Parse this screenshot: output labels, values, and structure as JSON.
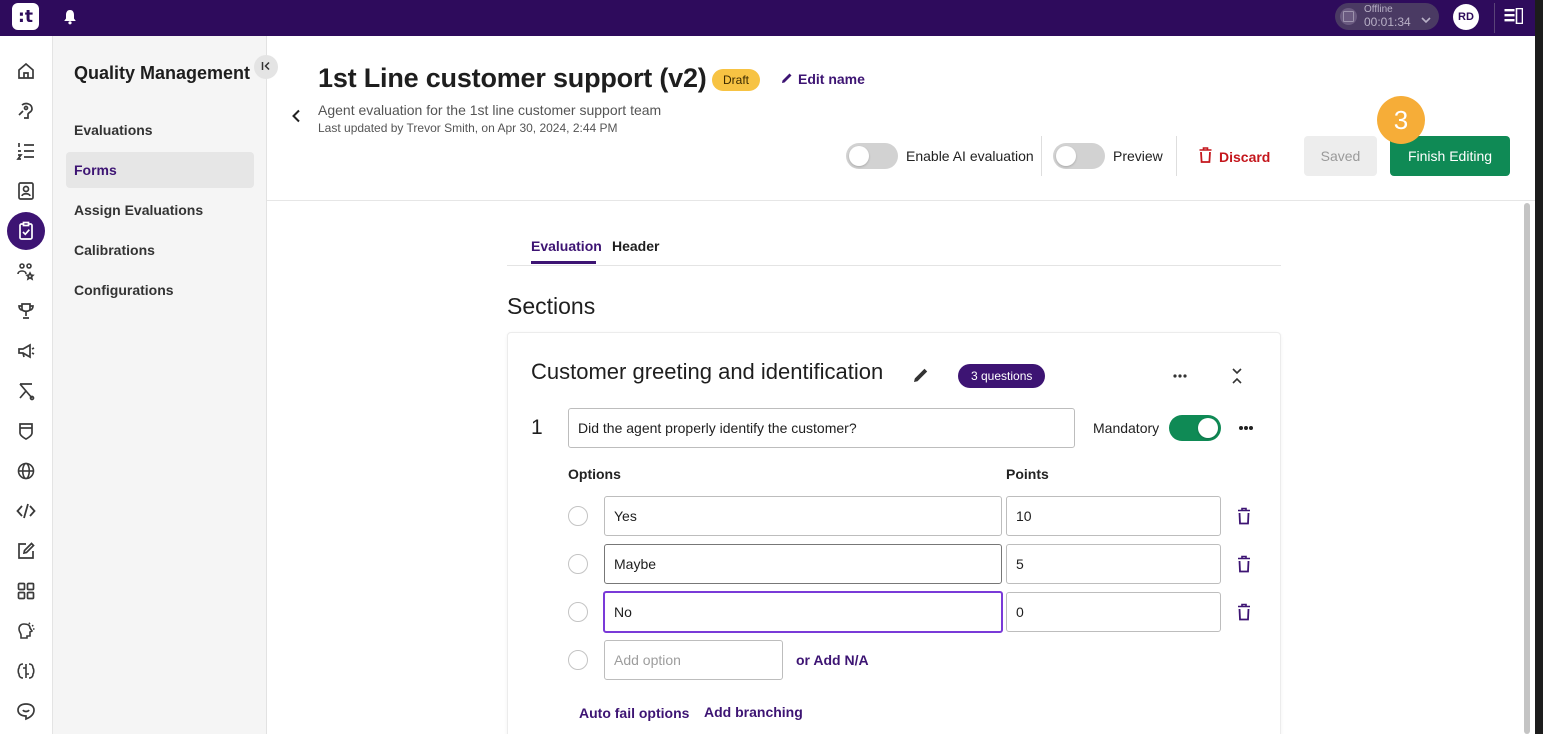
{
  "app": {
    "logo_text": ":t",
    "connection_status": "Offline",
    "session_timer": "00:01:34",
    "user_initials": "RD",
    "colors": {
      "brand": "#2e0b5c",
      "accent": "#3d1473",
      "primary_action": "#0f8a55",
      "danger": "#c4161c",
      "draft_badge": "#f7c343",
      "step_badge": "#f6ad38"
    }
  },
  "rail": {
    "icons": [
      "home-icon",
      "agent-assist-icon",
      "list-icon",
      "contacts-icon",
      "quality-management-icon",
      "team-rewards-icon",
      "trophy-icon",
      "campaign-icon",
      "flow-icon",
      "shield-icon",
      "globe-icon",
      "code-icon",
      "edit-note-icon",
      "apps-grid-icon",
      "ai-brain-icon",
      "integrations-icon",
      "chat-feedback-icon"
    ],
    "active": "quality-management-icon"
  },
  "sidebar": {
    "title": "Quality Management",
    "items": [
      {
        "label": "Evaluations",
        "active": false
      },
      {
        "label": "Forms",
        "active": true
      },
      {
        "label": "Assign Evaluations",
        "active": false
      },
      {
        "label": "Calibrations",
        "active": false
      },
      {
        "label": "Configurations",
        "active": false
      }
    ]
  },
  "header": {
    "title": "1st Line customer support (v2)",
    "status_badge": "Draft",
    "edit_name_label": "Edit name",
    "subtitle": "Agent evaluation for the 1st line customer support team",
    "last_updated": "Last updated by Trevor Smith, on Apr 30, 2024, 2:44 PM",
    "ai_toggle_label": "Enable AI evaluation",
    "ai_toggle_on": false,
    "preview_toggle_label": "Preview",
    "preview_toggle_on": false,
    "discard_label": "Discard",
    "saved_label": "Saved",
    "finish_label": "Finish Editing",
    "step_number": "3"
  },
  "tabs": [
    {
      "label": "Evaluation",
      "active": true
    },
    {
      "label": "Header",
      "active": false
    }
  ],
  "sections_title": "Sections",
  "section": {
    "name": "Customer greeting and identification",
    "question_count": "3 questions",
    "question": {
      "number": "1",
      "text": "Did the agent properly identify the customer?",
      "mandatory_label": "Mandatory",
      "mandatory_on": true,
      "options_header": "Options",
      "points_header": "Points",
      "options": [
        {
          "label": "Yes",
          "points": "10"
        },
        {
          "label": "Maybe",
          "points": "5"
        },
        {
          "label": "No",
          "points": "0"
        }
      ],
      "add_option_placeholder": "Add option",
      "add_na_label": "or Add N/A",
      "auto_fail_label": "Auto fail options",
      "add_branching_label": "Add branching"
    }
  }
}
